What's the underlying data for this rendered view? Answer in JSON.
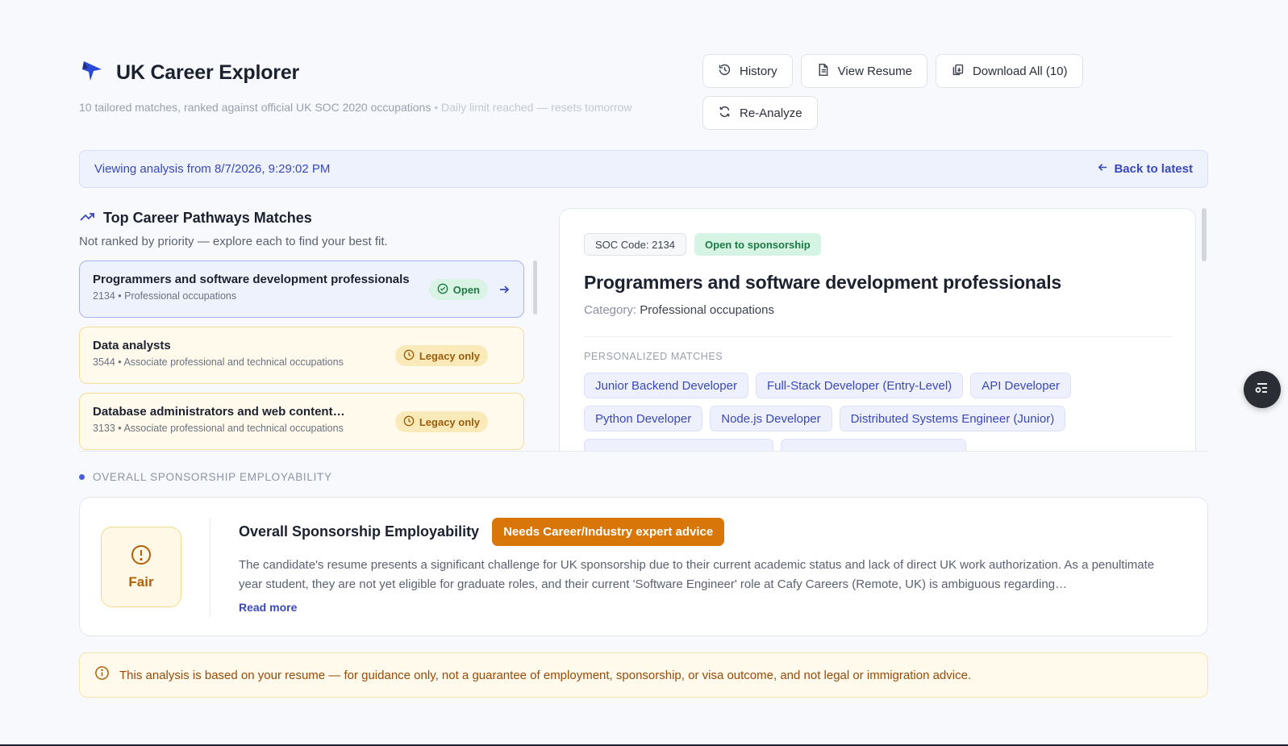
{
  "header": {
    "title": "UK Career Explorer",
    "subtitle": "10 tailored matches, ranked against official UK SOC 2020 occupations",
    "limit_note": "• Daily limit reached — resets tomorrow"
  },
  "actions": {
    "history": "History",
    "view_resume": "View Resume",
    "download_all": "Download All (10)",
    "reanalyze": "Re-Analyze"
  },
  "banner": {
    "text": "Viewing analysis from 8/7/2026, 9:29:02 PM",
    "back": "Back to latest"
  },
  "matches": {
    "title": "Top Career Pathways Matches",
    "subtitle": "Not ranked by priority — explore each to find your best fit.",
    "items": [
      {
        "title": "Programmers and software development professionals",
        "meta": "2134 • Professional occupations",
        "badge": "Open"
      },
      {
        "title": "Data analysts",
        "meta": "3544 • Associate professional and technical occupations",
        "badge": "Legacy only"
      },
      {
        "title": "Database administrators and web content…",
        "meta": "3133 • Associate professional and technical occupations",
        "badge": "Legacy only"
      }
    ]
  },
  "detail": {
    "soc": "SOC Code: 2134",
    "status": "Open to sponsorship",
    "title": "Programmers and software development professionals",
    "category_label": "Category:",
    "category_value": "Professional occupations",
    "pm_label": "PERSONALIZED MATCHES",
    "chips": [
      "Junior Backend Developer",
      "Full-Stack Developer (Entry-Level)",
      "API Developer",
      "Python Developer",
      "Node.js Developer",
      "Distributed Systems Engineer (Junior)"
    ]
  },
  "overall": {
    "section_label": "OVERALL SPONSORSHIP EMPLOYABILITY",
    "rating": "Fair",
    "title": "Overall Sponsorship Employability",
    "badge": "Needs Career/Industry expert advice",
    "text": "The candidate's resume presents a significant challenge for UK sponsorship due to their current academic status and lack of direct UK work authorization. As a penultimate year student, they are not yet eligible for graduate roles, and their current 'Software Engineer' role at Cafy Careers (Remote, UK) is ambiguous regarding…",
    "read_more": "Read more"
  },
  "disclaimer": "This analysis is based on your resume — for guidance only, not a guarantee of employment, sponsorship, or visa outcome, and not legal or immigration advice.",
  "colors": {
    "accent": "#3a48b8",
    "open_green": "#1d7a47",
    "legacy_amber": "#9a5d0a",
    "advice_orange": "#d9760a"
  },
  "icons": {
    "logo": "bird-logo-icon",
    "history": "history-icon",
    "resume": "document-icon",
    "download": "copy-download-icon",
    "reanalyze": "refresh-icon",
    "back": "arrow-left-icon",
    "trend": "trending-up-icon",
    "open": "check-circle-icon",
    "legacy": "clock-icon",
    "arrow": "arrow-right-icon",
    "alert": "alert-circle-icon",
    "info": "info-icon",
    "fab": "toggle-list-icon"
  }
}
